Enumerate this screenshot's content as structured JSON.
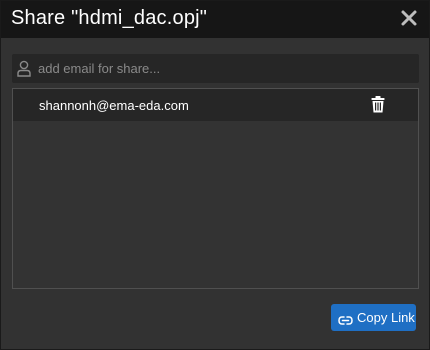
{
  "dialog": {
    "title": "Share \"hdmi_dac.opj\""
  },
  "search": {
    "placeholder": "add email for share...",
    "value": "",
    "icon": "user-icon"
  },
  "shares": [
    {
      "email": "shannonh@ema-eda.com",
      "action_icon": "trash-icon"
    }
  ],
  "footer": {
    "copy_link_label": "Copy Link",
    "copy_link_icon": "link-icon"
  },
  "colors": {
    "titlebar": "#161616",
    "dialog_bg": "#323232",
    "input_bg": "#262626",
    "row_bg": "#262626",
    "accent": "#1f6fc4",
    "text": "#ffffff",
    "placeholder": "#8a8a8a"
  }
}
